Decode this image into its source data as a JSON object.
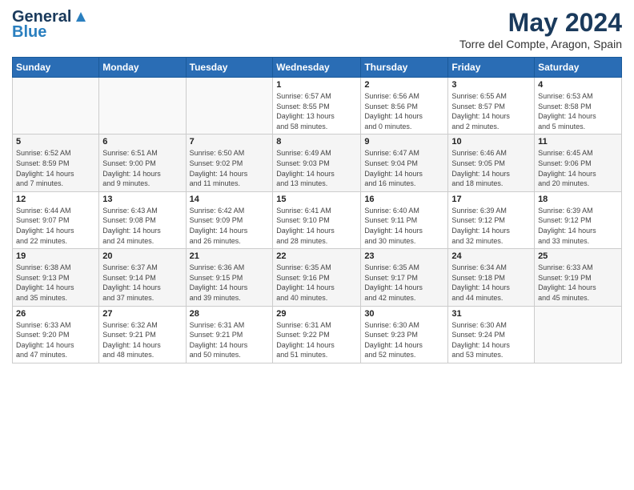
{
  "header": {
    "logo_line1": "General",
    "logo_line2": "Blue",
    "month": "May 2024",
    "location": "Torre del Compte, Aragon, Spain"
  },
  "weekdays": [
    "Sunday",
    "Monday",
    "Tuesday",
    "Wednesday",
    "Thursday",
    "Friday",
    "Saturday"
  ],
  "weeks": [
    [
      {
        "day": "",
        "info": ""
      },
      {
        "day": "",
        "info": ""
      },
      {
        "day": "",
        "info": ""
      },
      {
        "day": "1",
        "info": "Sunrise: 6:57 AM\nSunset: 8:55 PM\nDaylight: 13 hours\nand 58 minutes."
      },
      {
        "day": "2",
        "info": "Sunrise: 6:56 AM\nSunset: 8:56 PM\nDaylight: 14 hours\nand 0 minutes."
      },
      {
        "day": "3",
        "info": "Sunrise: 6:55 AM\nSunset: 8:57 PM\nDaylight: 14 hours\nand 2 minutes."
      },
      {
        "day": "4",
        "info": "Sunrise: 6:53 AM\nSunset: 8:58 PM\nDaylight: 14 hours\nand 5 minutes."
      }
    ],
    [
      {
        "day": "5",
        "info": "Sunrise: 6:52 AM\nSunset: 8:59 PM\nDaylight: 14 hours\nand 7 minutes."
      },
      {
        "day": "6",
        "info": "Sunrise: 6:51 AM\nSunset: 9:00 PM\nDaylight: 14 hours\nand 9 minutes."
      },
      {
        "day": "7",
        "info": "Sunrise: 6:50 AM\nSunset: 9:02 PM\nDaylight: 14 hours\nand 11 minutes."
      },
      {
        "day": "8",
        "info": "Sunrise: 6:49 AM\nSunset: 9:03 PM\nDaylight: 14 hours\nand 13 minutes."
      },
      {
        "day": "9",
        "info": "Sunrise: 6:47 AM\nSunset: 9:04 PM\nDaylight: 14 hours\nand 16 minutes."
      },
      {
        "day": "10",
        "info": "Sunrise: 6:46 AM\nSunset: 9:05 PM\nDaylight: 14 hours\nand 18 minutes."
      },
      {
        "day": "11",
        "info": "Sunrise: 6:45 AM\nSunset: 9:06 PM\nDaylight: 14 hours\nand 20 minutes."
      }
    ],
    [
      {
        "day": "12",
        "info": "Sunrise: 6:44 AM\nSunset: 9:07 PM\nDaylight: 14 hours\nand 22 minutes."
      },
      {
        "day": "13",
        "info": "Sunrise: 6:43 AM\nSunset: 9:08 PM\nDaylight: 14 hours\nand 24 minutes."
      },
      {
        "day": "14",
        "info": "Sunrise: 6:42 AM\nSunset: 9:09 PM\nDaylight: 14 hours\nand 26 minutes."
      },
      {
        "day": "15",
        "info": "Sunrise: 6:41 AM\nSunset: 9:10 PM\nDaylight: 14 hours\nand 28 minutes."
      },
      {
        "day": "16",
        "info": "Sunrise: 6:40 AM\nSunset: 9:11 PM\nDaylight: 14 hours\nand 30 minutes."
      },
      {
        "day": "17",
        "info": "Sunrise: 6:39 AM\nSunset: 9:12 PM\nDaylight: 14 hours\nand 32 minutes."
      },
      {
        "day": "18",
        "info": "Sunrise: 6:39 AM\nSunset: 9:12 PM\nDaylight: 14 hours\nand 33 minutes."
      }
    ],
    [
      {
        "day": "19",
        "info": "Sunrise: 6:38 AM\nSunset: 9:13 PM\nDaylight: 14 hours\nand 35 minutes."
      },
      {
        "day": "20",
        "info": "Sunrise: 6:37 AM\nSunset: 9:14 PM\nDaylight: 14 hours\nand 37 minutes."
      },
      {
        "day": "21",
        "info": "Sunrise: 6:36 AM\nSunset: 9:15 PM\nDaylight: 14 hours\nand 39 minutes."
      },
      {
        "day": "22",
        "info": "Sunrise: 6:35 AM\nSunset: 9:16 PM\nDaylight: 14 hours\nand 40 minutes."
      },
      {
        "day": "23",
        "info": "Sunrise: 6:35 AM\nSunset: 9:17 PM\nDaylight: 14 hours\nand 42 minutes."
      },
      {
        "day": "24",
        "info": "Sunrise: 6:34 AM\nSunset: 9:18 PM\nDaylight: 14 hours\nand 44 minutes."
      },
      {
        "day": "25",
        "info": "Sunrise: 6:33 AM\nSunset: 9:19 PM\nDaylight: 14 hours\nand 45 minutes."
      }
    ],
    [
      {
        "day": "26",
        "info": "Sunrise: 6:33 AM\nSunset: 9:20 PM\nDaylight: 14 hours\nand 47 minutes."
      },
      {
        "day": "27",
        "info": "Sunrise: 6:32 AM\nSunset: 9:21 PM\nDaylight: 14 hours\nand 48 minutes."
      },
      {
        "day": "28",
        "info": "Sunrise: 6:31 AM\nSunset: 9:21 PM\nDaylight: 14 hours\nand 50 minutes."
      },
      {
        "day": "29",
        "info": "Sunrise: 6:31 AM\nSunset: 9:22 PM\nDaylight: 14 hours\nand 51 minutes."
      },
      {
        "day": "30",
        "info": "Sunrise: 6:30 AM\nSunset: 9:23 PM\nDaylight: 14 hours\nand 52 minutes."
      },
      {
        "day": "31",
        "info": "Sunrise: 6:30 AM\nSunset: 9:24 PM\nDaylight: 14 hours\nand 53 minutes."
      },
      {
        "day": "",
        "info": ""
      }
    ]
  ]
}
